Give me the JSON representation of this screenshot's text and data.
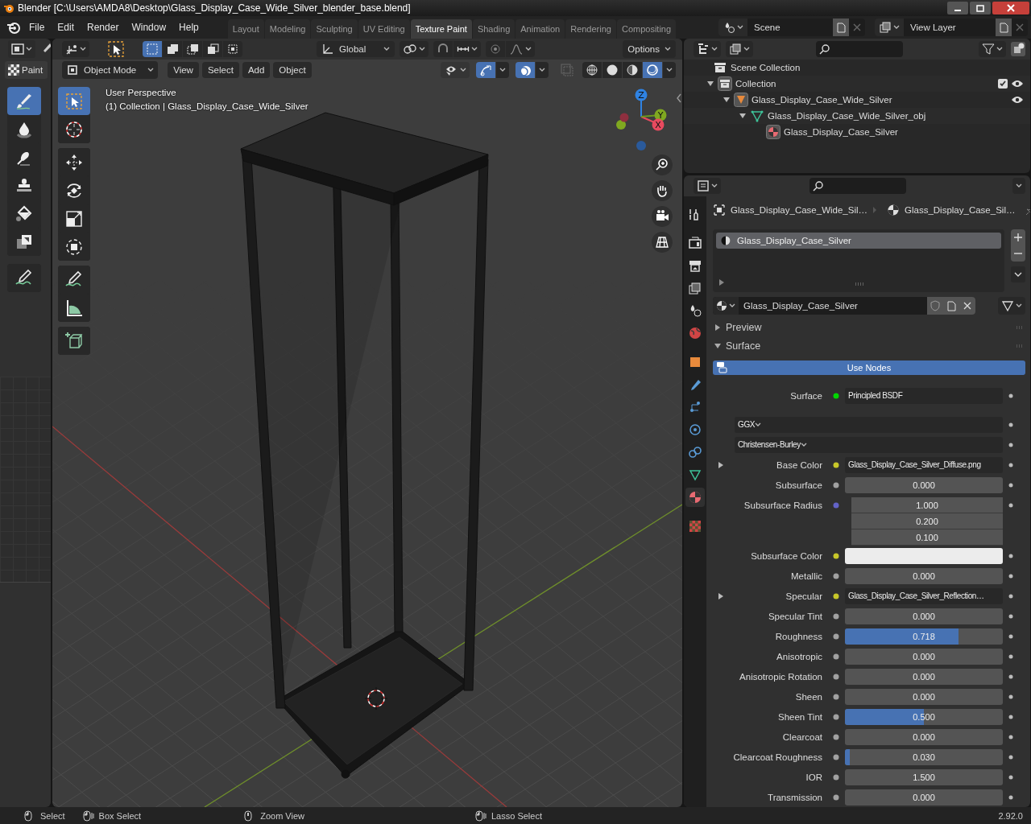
{
  "window": {
    "title": "Blender [C:\\Users\\AMDA8\\Desktop\\Glass_Display_Case_Wide_Silver_blender_base.blend]"
  },
  "menu": [
    "File",
    "Edit",
    "Render",
    "Window",
    "Help"
  ],
  "workspaces": [
    {
      "label": "Layout",
      "selected": false
    },
    {
      "label": "Modeling",
      "selected": false
    },
    {
      "label": "Sculpting",
      "selected": false
    },
    {
      "label": "UV Editing",
      "selected": false
    },
    {
      "label": "Texture Paint",
      "selected": true
    },
    {
      "label": "Shading",
      "selected": false
    },
    {
      "label": "Animation",
      "selected": false
    },
    {
      "label": "Rendering",
      "selected": false
    },
    {
      "label": "Compositing",
      "selected": false
    }
  ],
  "scene": "Scene",
  "view_layer": "View Layer",
  "image_editor": {
    "tab": "Paint",
    "tools": [
      {
        "kind": "draw",
        "selected": true
      },
      {
        "kind": "soften",
        "selected": false
      },
      {
        "kind": "smear",
        "selected": false
      },
      {
        "kind": "clone",
        "selected": false
      },
      {
        "kind": "fill",
        "selected": false
      },
      {
        "kind": "mask",
        "selected": false
      },
      {
        "kind": "annotate",
        "selected": false
      }
    ]
  },
  "tool_header": {
    "orientation": "Global",
    "options": "Options"
  },
  "viewport": {
    "mode": "Object Mode",
    "menus": [
      "View",
      "Select",
      "Add",
      "Object"
    ],
    "info": [
      "User Perspective",
      "(1) Collection | Glass_Display_Case_Wide_Silver"
    ],
    "tools": [
      {
        "kind": "select_box",
        "selected": true
      },
      {
        "kind": "cursor",
        "selected": false
      },
      {
        "kind": "move",
        "selected": false
      },
      {
        "kind": "rotate",
        "selected": false
      },
      {
        "kind": "scale",
        "selected": false
      },
      {
        "kind": "transform",
        "selected": false
      },
      {
        "kind": "annotate",
        "selected": false
      },
      {
        "kind": "measure",
        "selected": false
      },
      {
        "kind": "add_cube",
        "selected": false
      }
    ],
    "gizmo": {
      "z": "Z",
      "y": "Y",
      "x": "X"
    }
  },
  "outliner": {
    "items": [
      {
        "kind": "scene_collection",
        "name": "Scene Collection",
        "visible": false,
        "children": [
          {
            "kind": "collection",
            "name": "Collection",
            "expanded": true,
            "checked": true,
            "visible": true,
            "children": [
              {
                "kind": "object",
                "name": "Glass_Display_Case_Wide_Silver",
                "expanded": true,
                "visible": true,
                "children": [
                  {
                    "kind": "mesh",
                    "name": "Glass_Display_Case_Wide_Silver_obj",
                    "expanded": true,
                    "visible": false,
                    "children": [
                      {
                        "kind": "material",
                        "name": "Glass_Display_Case_Silver",
                        "visible": false
                      }
                    ]
                  }
                ]
              }
            ]
          }
        ]
      }
    ]
  },
  "properties": {
    "tabs": [
      {
        "kind": "tool",
        "selected": false
      },
      {
        "kind": "render",
        "selected": false
      },
      {
        "kind": "output",
        "selected": false
      },
      {
        "kind": "view_layer",
        "selected": false
      },
      {
        "kind": "scene",
        "selected": false
      },
      {
        "kind": "world",
        "selected": false
      },
      {
        "kind": "object",
        "selected": false
      },
      {
        "kind": "modifiers",
        "selected": false
      },
      {
        "kind": "particles",
        "selected": false
      },
      {
        "kind": "physics",
        "selected": false
      },
      {
        "kind": "constraints",
        "selected": false
      },
      {
        "kind": "data",
        "selected": false
      },
      {
        "kind": "material",
        "selected": true
      },
      {
        "kind": "texture",
        "selected": false
      }
    ],
    "breadcrumb": [
      "Glass_Display_Case_Wide_Sil…",
      "Glass_Display_Case_Sil…"
    ],
    "slots": [
      {
        "name": "Glass_Display_Case_Silver",
        "selected": true
      }
    ],
    "material": "Glass_Display_Case_Silver",
    "panels": [
      {
        "title": "Preview",
        "expanded": false
      },
      {
        "title": "Surface",
        "expanded": true
      }
    ],
    "use_nodes": {
      "label": "Use Nodes",
      "on": true
    },
    "rows": [
      {
        "kind": "link",
        "label": "Surface",
        "value": "Principled BSDF",
        "color": "#00d600"
      },
      {
        "kind": "dropdown",
        "value": "GGX"
      },
      {
        "kind": "dropdown",
        "value": "Christensen-Burley"
      },
      {
        "kind": "link",
        "label": "Base Color",
        "value": "Glass_Display_Case_Silver_Diffuse.png",
        "color": "#c7c729",
        "expandable": true
      },
      {
        "kind": "slider",
        "label": "Subsurface",
        "value": "0.000",
        "level": 0,
        "color": "#a1a1a1"
      },
      {
        "kind": "vector",
        "label": "Subsurface Radius",
        "values": [
          "1.000",
          "0.200",
          "0.100"
        ],
        "color": "#6363c7"
      },
      {
        "kind": "swatch",
        "label": "Subsurface Color",
        "color": "#c7c729"
      },
      {
        "kind": "slider",
        "label": "Metallic",
        "value": "0.000",
        "level": 0,
        "color": "#a1a1a1"
      },
      {
        "kind": "link",
        "label": "Specular",
        "value": "Glass_Display_Case_Silver_Reflection…",
        "color": "#c7c729",
        "expandable": true
      },
      {
        "kind": "slider",
        "label": "Specular Tint",
        "value": "0.000",
        "level": 0,
        "color": "#a1a1a1"
      },
      {
        "kind": "slider",
        "label": "Roughness",
        "value": "0.718",
        "level": 0.718,
        "color": "#a1a1a1"
      },
      {
        "kind": "slider",
        "label": "Anisotropic",
        "value": "0.000",
        "level": 0,
        "color": "#a1a1a1"
      },
      {
        "kind": "slider",
        "label": "Anisotropic Rotation",
        "value": "0.000",
        "level": 0,
        "color": "#a1a1a1"
      },
      {
        "kind": "slider",
        "label": "Sheen",
        "value": "0.000",
        "level": 0,
        "color": "#a1a1a1"
      },
      {
        "kind": "slider",
        "label": "Sheen Tint",
        "value": "0.500",
        "level": 0.5,
        "color": "#a1a1a1"
      },
      {
        "kind": "slider",
        "label": "Clearcoat",
        "value": "0.000",
        "level": 0,
        "color": "#a1a1a1"
      },
      {
        "kind": "slider",
        "label": "Clearcoat Roughness",
        "value": "0.030",
        "level": 0.03,
        "color": "#a1a1a1"
      },
      {
        "kind": "number",
        "label": "IOR",
        "value": "1.500",
        "color": "#a1a1a1"
      },
      {
        "kind": "slider",
        "label": "Transmission",
        "value": "0.000",
        "level": 0,
        "color": "#a1a1a1"
      }
    ]
  },
  "status_bar": {
    "hints": [
      {
        "kind": "left",
        "label": "Select"
      },
      {
        "kind": "drag",
        "label": "Box Select"
      },
      {
        "kind": "middle",
        "label": "Zoom View"
      },
      {
        "kind": "drag",
        "label": "Lasso Select"
      }
    ],
    "version": "2.92.0"
  }
}
